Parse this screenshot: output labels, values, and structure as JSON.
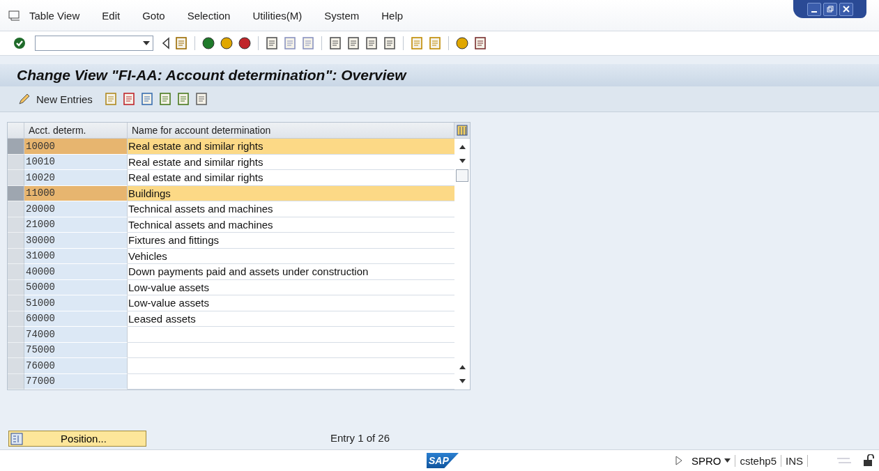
{
  "menu": [
    "Table View",
    "Edit",
    "Goto",
    "Selection",
    "Utilities(M)",
    "System",
    "Help"
  ],
  "title": "Change View \"FI-AA: Account determination\": Overview",
  "app_toolbar": {
    "new_entries": "New Entries"
  },
  "table": {
    "columns": [
      "Acct. determ.",
      "Name for account determination"
    ],
    "rows": [
      {
        "code": "10000",
        "name": "Real estate and similar rights",
        "selected": true
      },
      {
        "code": "10010",
        "name": "Real estate and similar rights",
        "selected": false
      },
      {
        "code": "10020",
        "name": "Real estate and similar rights",
        "selected": false
      },
      {
        "code": "11000",
        "name": "Buildings",
        "selected": true
      },
      {
        "code": "20000",
        "name": "Technical assets and machines",
        "selected": false
      },
      {
        "code": "21000",
        "name": "Technical assets and machines",
        "selected": false
      },
      {
        "code": "30000",
        "name": "Fixtures and fittings",
        "selected": false
      },
      {
        "code": "31000",
        "name": "Vehicles",
        "selected": false
      },
      {
        "code": "40000",
        "name": "Down payments paid and assets under construction",
        "selected": false
      },
      {
        "code": "50000",
        "name": "Low-value assets",
        "selected": false
      },
      {
        "code": "51000",
        "name": "Low-value assets",
        "selected": false
      },
      {
        "code": "60000",
        "name": "Leased assets",
        "selected": false
      },
      {
        "code": "74000",
        "name": "",
        "selected": false
      },
      {
        "code": "75000",
        "name": "",
        "selected": false
      },
      {
        "code": "76000",
        "name": "",
        "selected": false
      },
      {
        "code": "77000",
        "name": "",
        "selected": false
      }
    ]
  },
  "position_button": "Position...",
  "entry_info": "Entry 1 of 26",
  "status_bar": {
    "logo": "SAP",
    "transaction": "SPRO",
    "server": "cstehp5",
    "mode": "INS"
  }
}
